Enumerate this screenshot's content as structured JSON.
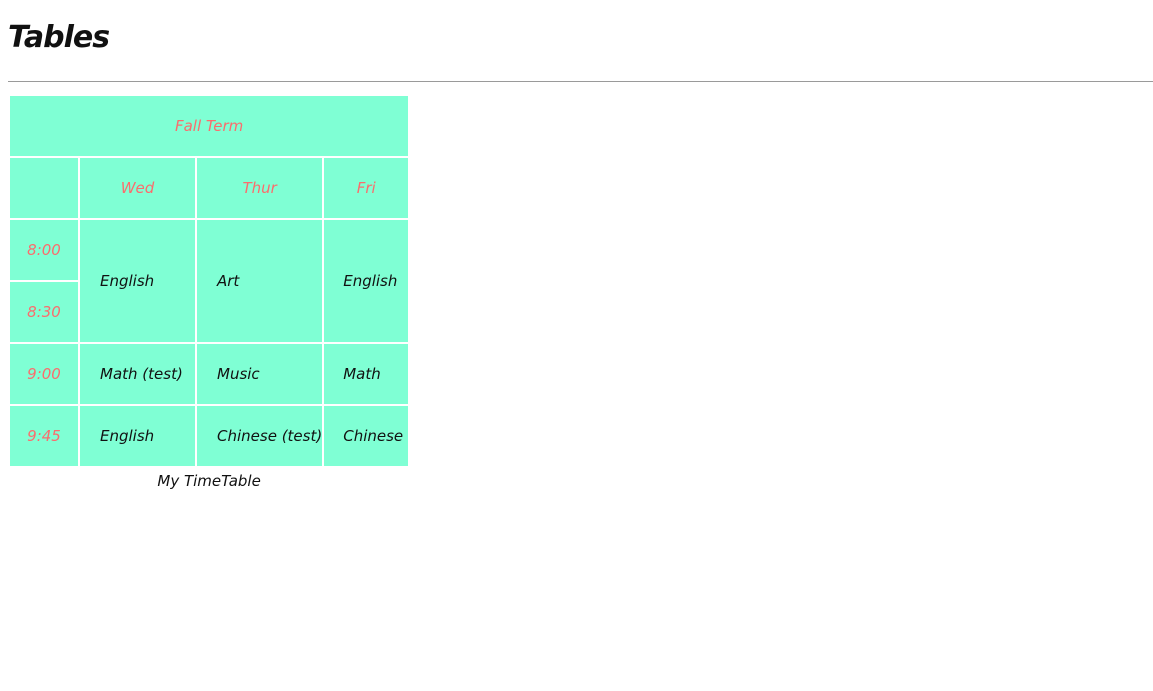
{
  "page": {
    "title": "Tables"
  },
  "timetable": {
    "term": "Fall Term",
    "days": [
      "Wed",
      "Thur",
      "Fri"
    ],
    "times": [
      "8:00",
      "8:30",
      "9:00",
      "9:45"
    ],
    "rows": [
      {
        "time": "8:00 / 8:30",
        "wed": "English",
        "thur": "Art",
        "fri": "English"
      },
      {
        "time": "9:00",
        "wed": "Math (test)",
        "thur": "Music",
        "fri": "Math"
      },
      {
        "time": "9:45",
        "wed": "English",
        "thur": "Chinese (test)",
        "fri": "Chinese"
      }
    ],
    "caption": "My TimeTable"
  },
  "colors": {
    "cell_background": "#7fffd4",
    "header_text": "#fb6d6d",
    "body_text": "#111111",
    "divider": "#9a9a9a"
  }
}
